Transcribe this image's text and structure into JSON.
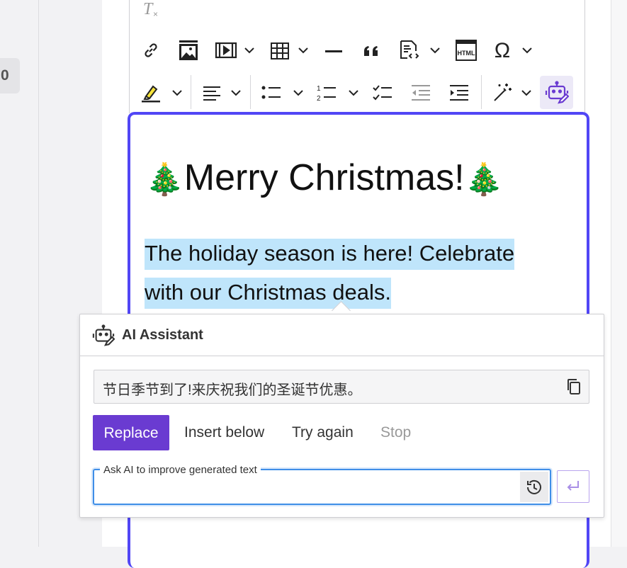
{
  "sidebar": {
    "badge_text": "0"
  },
  "toolbar": {
    "icons": [
      "remove-format-icon",
      "link-icon",
      "insert-image-icon",
      "media-embed-icon",
      "table-icon",
      "horizontal-line-icon",
      "block-quote-icon",
      "source-code-icon",
      "html-embed-icon",
      "special-characters-icon",
      "highlight-icon",
      "align-left-icon",
      "bulleted-list-icon",
      "numbered-list-icon",
      "todo-list-icon",
      "outdent-icon",
      "indent-icon",
      "magic-wand-icon",
      "ai-assistant-icon"
    ],
    "html_badge": "HTML",
    "omega": "Ω"
  },
  "editor": {
    "heading": {
      "emoji_left": "🎄",
      "text": "Merry Christmas!",
      "emoji_right": "🎄"
    },
    "paragraph_line1": "The holiday season is here! Celebrate",
    "paragraph_line2": "with our Christmas deals."
  },
  "ai_panel": {
    "title": "AI Assistant",
    "result_text": "节日季节到了!来庆祝我们的圣诞节优惠。",
    "actions": {
      "replace": "Replace",
      "insert_below": "Insert below",
      "try_again": "Try again",
      "stop": "Stop"
    },
    "input": {
      "label": "Ask AI to improve generated text",
      "value": ""
    }
  },
  "colors": {
    "accent_purple": "#6a3bd1",
    "editor_border": "#5146f5",
    "selection": "#bfe5fb",
    "focus_blue": "#3f8ee7"
  }
}
